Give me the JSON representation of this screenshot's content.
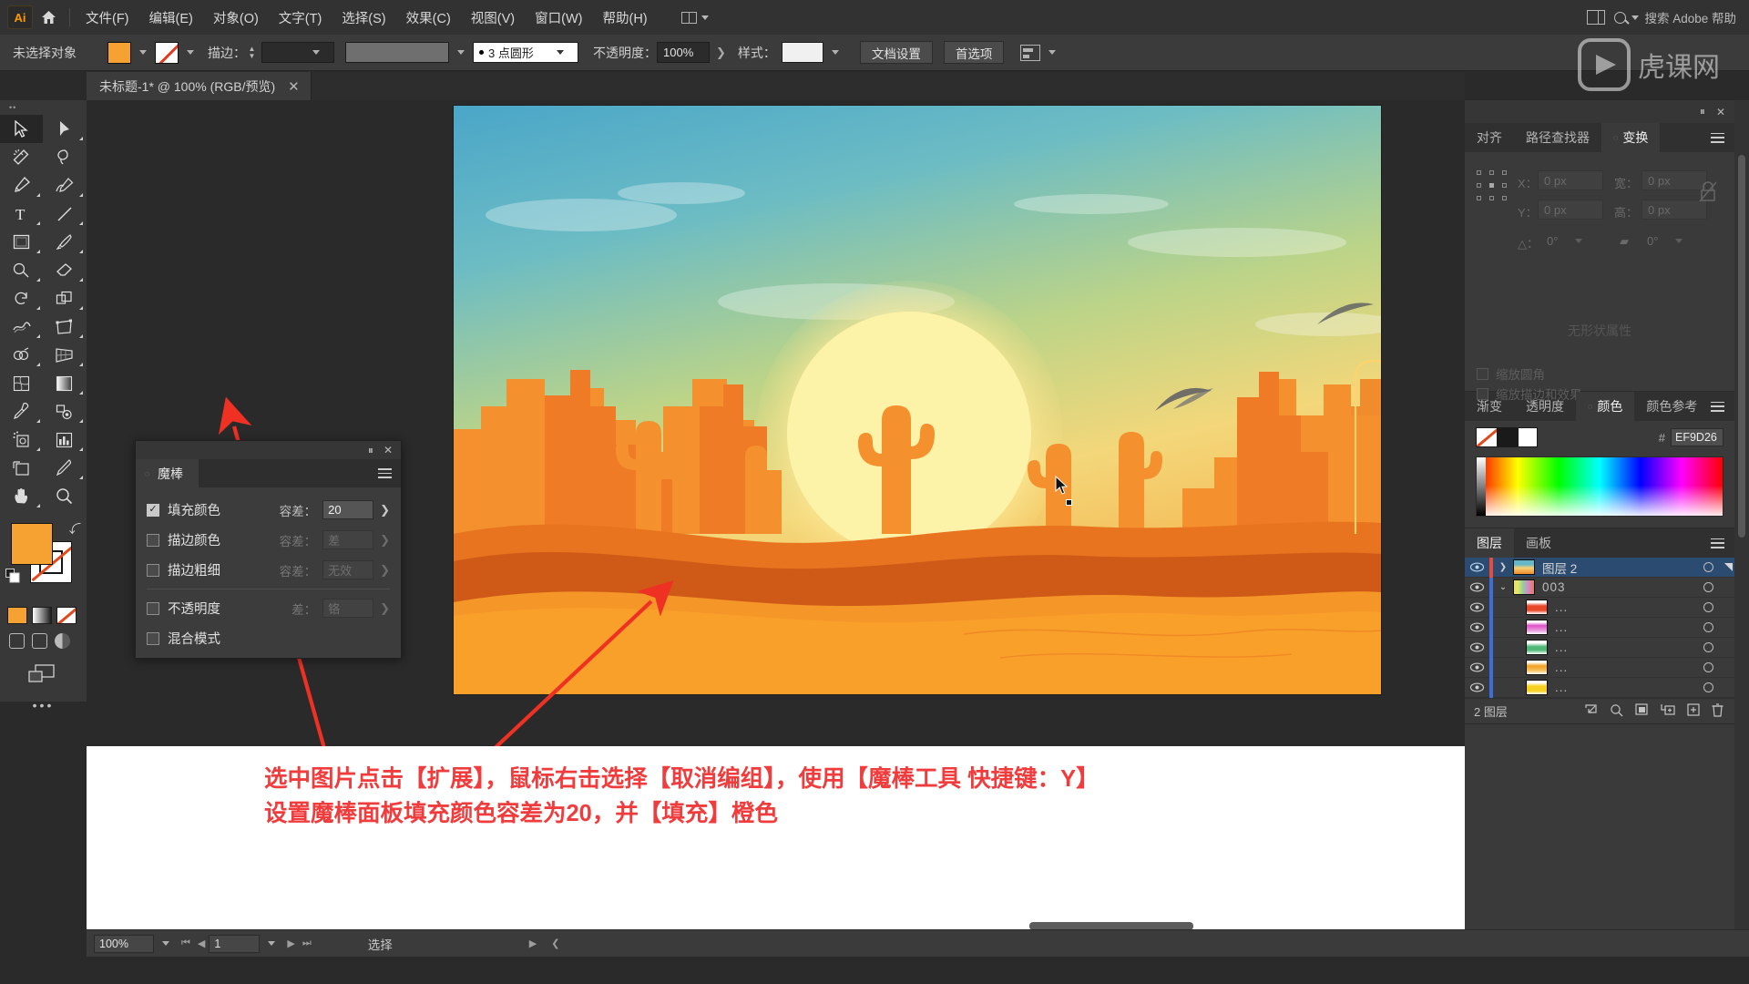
{
  "app": {
    "logo": "Ai",
    "home_icon": "home-icon"
  },
  "menubar": {
    "items": [
      "文件(F)",
      "编辑(E)",
      "对象(O)",
      "文字(T)",
      "选择(S)",
      "效果(C)",
      "视图(V)",
      "窗口(W)",
      "帮助(H)"
    ],
    "workspace_label": "",
    "search_placeholder": "搜索 Adobe 帮助"
  },
  "optionsbar": {
    "no_selection": "未选择对象",
    "stroke_label": "描边：",
    "stroke_weight": "",
    "profile": "3 点圆形",
    "opacity_label": "不透明度：",
    "opacity_value": "100%",
    "style_label": "样式：",
    "doc_setup": "文档设置",
    "preferences": "首选项"
  },
  "tab": {
    "title": "未标题-1* @ 100% (RGB/预览)",
    "close": "✕"
  },
  "toolbar": {
    "tools": [
      "selection-tool",
      "direct-selection-tool",
      "magic-wand-tool",
      "lasso-tool",
      "pen-tool",
      "curvature-tool",
      "type-tool",
      "line-segment-tool",
      "rectangle-tool",
      "paintbrush-tool",
      "shaper-tool",
      "eraser-tool",
      "rotate-tool",
      "scale-tool",
      "width-tool",
      "free-transform-tool",
      "shape-builder-tool",
      "perspective-grid-tool",
      "mesh-tool",
      "gradient-tool",
      "eyedropper-tool",
      "blend-tool",
      "symbol-sprayer-tool",
      "column-graph-tool",
      "artboard-tool",
      "slice-tool",
      "hand-tool",
      "zoom-tool"
    ],
    "fill_color": "#f5a233",
    "stroke_color": "#ffffff",
    "more_dots": "•••"
  },
  "magic_wand_panel": {
    "title": "魔棒",
    "collapse_icon": "collapse-icon",
    "close_icon": "✕",
    "menu_icon": "panel-menu-icon",
    "rows": [
      {
        "label": "填充颜色",
        "checked": true,
        "tolerance_label": "容差：",
        "tolerance_value": "20",
        "enabled": true
      },
      {
        "label": "描边颜色",
        "checked": false,
        "tolerance_label": "容差：",
        "tolerance_value": "差",
        "enabled": false
      },
      {
        "label": "描边粗细",
        "checked": false,
        "tolerance_label": "容差：",
        "tolerance_value": "无效",
        "enabled": false
      },
      {
        "label": "不透明度",
        "checked": false,
        "tolerance_label": "差：",
        "tolerance_value": "铬",
        "enabled": false
      },
      {
        "label": "混合模式",
        "checked": false,
        "tolerance_label": "",
        "tolerance_value": "",
        "enabled": false
      }
    ]
  },
  "annotation": {
    "line1": "选中图片点击【扩展】，鼠标右击选择【取消编组】，使用【魔棒工具 快捷键：Y】",
    "line2": "设置魔棒面板填充颜色容差为20，并【填充】橙色",
    "color": "#f03c3c"
  },
  "right_dock": {
    "transform_group": {
      "tabs": [
        "对齐",
        "路径查找器",
        "变换"
      ],
      "active_tab": "变换",
      "fields": {
        "x_label": "X：",
        "x_value": "0 px",
        "y_label": "Y：",
        "y_value": "0 px",
        "w_label": "宽：",
        "w_value": "0 px",
        "h_label": "高：",
        "h_value": "0 px",
        "angle_label": "△：",
        "angle_value": "0°",
        "shear_label": "",
        "shear_value": "0°"
      },
      "no_properties": "无形状属性",
      "checkbox1": "缩放圆角",
      "checkbox2": "缩放描边和效果"
    },
    "color_group": {
      "tabs": [
        "渐变",
        "透明度",
        "颜色",
        "颜色参考"
      ],
      "active_tab": "颜色",
      "hash": "#",
      "hex": "EF9D26"
    },
    "layers_group": {
      "tabs": [
        "图层",
        "画板"
      ],
      "active_tab": "图层",
      "rows": [
        {
          "name": "图层 2",
          "selected": true,
          "indent": 0,
          "expanded": false,
          "thumb": "artwork",
          "color": "#e84b3a"
        },
        {
          "name": "003",
          "selected": false,
          "indent": 1,
          "expanded": true,
          "thumb": "artwork2",
          "color": "#3a6fd8"
        },
        {
          "name": "...",
          "selected": false,
          "indent": 2,
          "expanded": null,
          "thumb": "swatch",
          "color": "#e8482a"
        },
        {
          "name": "...",
          "selected": false,
          "indent": 2,
          "expanded": null,
          "thumb": "swatch",
          "color": "#e050c8"
        },
        {
          "name": "...",
          "selected": false,
          "indent": 2,
          "expanded": null,
          "thumb": "swatch",
          "color": "#4fb877"
        },
        {
          "name": "...",
          "selected": false,
          "indent": 2,
          "expanded": null,
          "thumb": "swatch",
          "color": "#f0a022"
        },
        {
          "name": "...",
          "selected": false,
          "indent": 2,
          "expanded": null,
          "thumb": "swatch",
          "color": "#f5d021"
        }
      ],
      "footer_count": "2 图层",
      "footer_icons": [
        "locate-object-icon",
        "search-icon",
        "make-clipping-mask-icon",
        "create-sublayer-icon",
        "new-layer-icon",
        "delete-layer-icon"
      ]
    }
  },
  "statusbar": {
    "zoom": "100%",
    "page": "1",
    "status_text": "选择"
  },
  "colors": {
    "orange_fill": "#F5A233",
    "accent_blue": "#2b4c70",
    "panel_bg": "#3a3a3a",
    "annotation_red": "#f03c3c",
    "arrow_red": "#ef3124"
  }
}
